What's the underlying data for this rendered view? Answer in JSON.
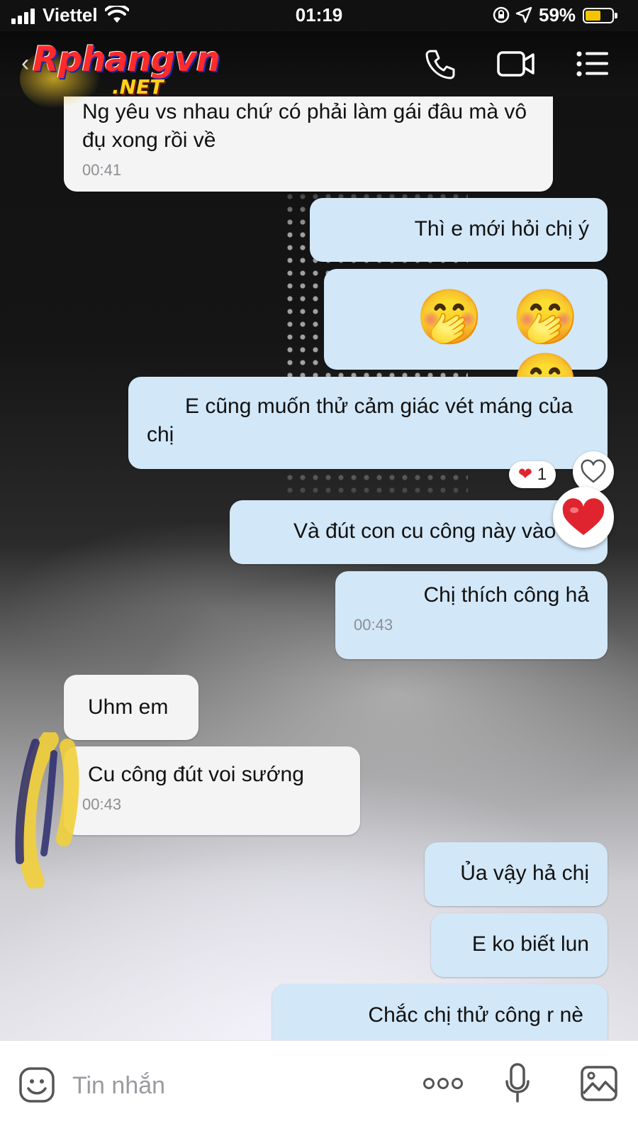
{
  "status_bar": {
    "carrier": "Viettel",
    "time": "01:19",
    "battery_percent": "59%",
    "battery_level": 0.59
  },
  "header": {
    "logo_main": "Rphangvn",
    "logo_net": ".NET",
    "icons": [
      "phone-icon",
      "video-call-icon",
      "menu-icon"
    ]
  },
  "messages": [
    {
      "side": "in",
      "text": "Ng yêu vs nhau chứ có phải làm gái đâu mà vô đụ xong rồi về",
      "time": "00:41"
    },
    {
      "side": "out",
      "text": "Thì e mới hỏi  chị ý"
    },
    {
      "side": "out",
      "text": "🤭 🤭 🤭"
    },
    {
      "side": "out",
      "text": "E cũng muốn thử cảm giác vét máng của chị",
      "reaction": {
        "emoji": "❤",
        "count": "1"
      }
    },
    {
      "side": "out",
      "text": "Và đút con cu công này vào chị"
    },
    {
      "side": "out",
      "text": "Chị thích công hả",
      "time": "00:43"
    },
    {
      "side": "in",
      "text": "Uhm em"
    },
    {
      "side": "in",
      "text": "Cu công đút voi sướng",
      "time": "00:43"
    },
    {
      "side": "out",
      "text": "Ủa vậy hả chị"
    },
    {
      "side": "out",
      "text": "E ko biết lun"
    },
    {
      "side": "out",
      "text": "Chắc chị thử công r nè"
    }
  ],
  "composer": {
    "placeholder": "Tin nhắn"
  },
  "colors": {
    "incoming_bubble": "#f4f4f4",
    "outgoing_bubble": "#d2e7f7",
    "battery": "#f5c400",
    "reaction_heart": "#e0242f"
  }
}
